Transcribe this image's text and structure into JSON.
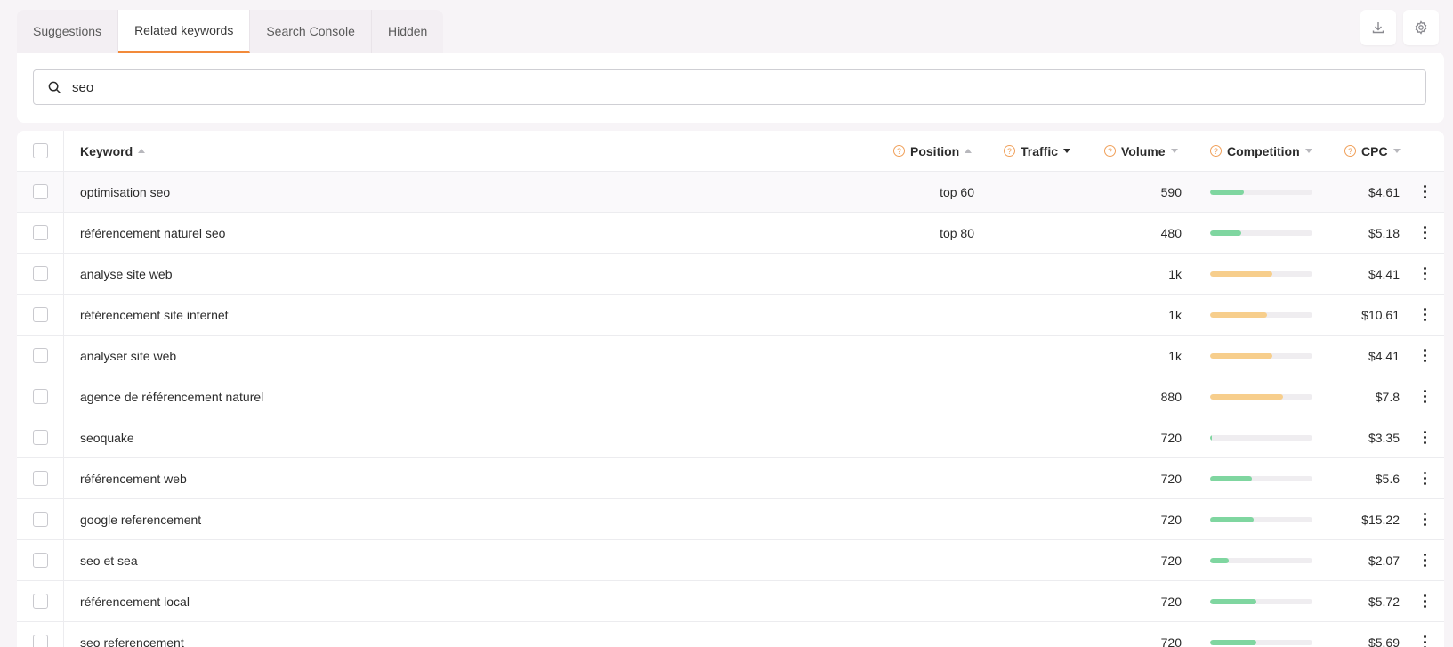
{
  "tabs": [
    "Suggestions",
    "Related keywords",
    "Search Console",
    "Hidden"
  ],
  "active_tab": "Related keywords",
  "search": {
    "value": "seo"
  },
  "columns": {
    "keyword": "Keyword",
    "position": "Position",
    "traffic": "Traffic",
    "volume": "Volume",
    "competition": "Competition",
    "cpc": "CPC"
  },
  "colors": {
    "accent": "#f28a3a",
    "comp_low": "#7fd6a0",
    "comp_mid": "#f7ce8c"
  },
  "rows": [
    {
      "keyword": "optimisation seo",
      "position": "top 60",
      "volume": "590",
      "competition": 0.33,
      "level": "low",
      "cpc": "$4.61"
    },
    {
      "keyword": "référencement naturel seo",
      "position": "top 80",
      "volume": "480",
      "competition": 0.3,
      "level": "low",
      "cpc": "$5.18"
    },
    {
      "keyword": "analyse site web",
      "position": "",
      "volume": "1k",
      "competition": 0.61,
      "level": "mid",
      "cpc": "$4.41"
    },
    {
      "keyword": "référencement site internet",
      "position": "",
      "volume": "1k",
      "competition": 0.56,
      "level": "mid",
      "cpc": "$10.61"
    },
    {
      "keyword": "analyser site web",
      "position": "",
      "volume": "1k",
      "competition": 0.61,
      "level": "mid",
      "cpc": "$4.41"
    },
    {
      "keyword": "agence de référencement naturel",
      "position": "",
      "volume": "880",
      "competition": 0.71,
      "level": "mid",
      "cpc": "$7.8"
    },
    {
      "keyword": "seoquake",
      "position": "",
      "volume": "720",
      "competition": 0.02,
      "level": "low",
      "cpc": "$3.35"
    },
    {
      "keyword": "référencement web",
      "position": "",
      "volume": "720",
      "competition": 0.41,
      "level": "low",
      "cpc": "$5.6"
    },
    {
      "keyword": "google referencement",
      "position": "",
      "volume": "720",
      "competition": 0.43,
      "level": "low",
      "cpc": "$15.22"
    },
    {
      "keyword": "seo et sea",
      "position": "",
      "volume": "720",
      "competition": 0.18,
      "level": "low",
      "cpc": "$2.07"
    },
    {
      "keyword": "référencement local",
      "position": "",
      "volume": "720",
      "competition": 0.45,
      "level": "low",
      "cpc": "$5.72"
    },
    {
      "keyword": "seo referencement",
      "position": "",
      "volume": "720",
      "competition": 0.45,
      "level": "low",
      "cpc": "$5.69"
    }
  ]
}
